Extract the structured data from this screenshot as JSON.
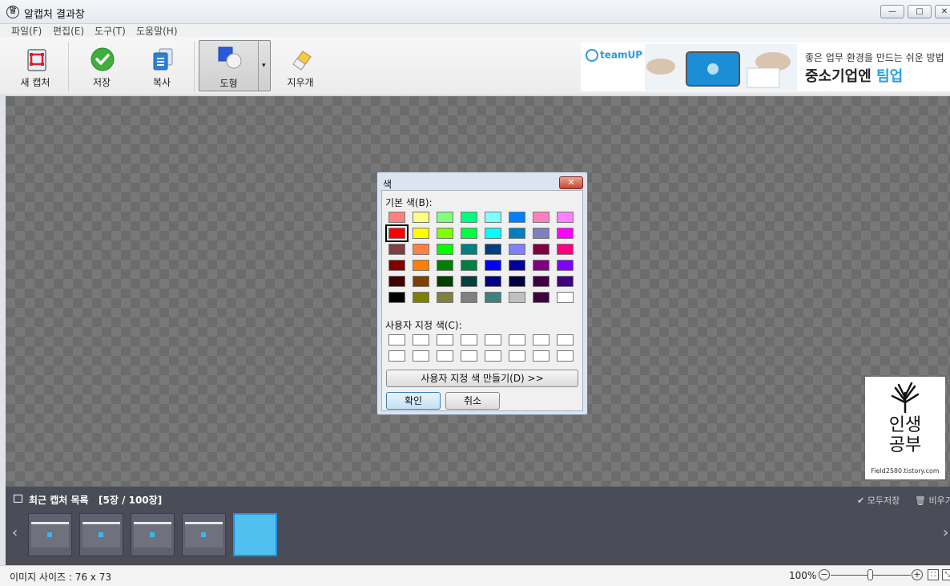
{
  "window": {
    "title": "알캡처 결과창",
    "minimize": "—",
    "maximize": "□",
    "close": "✕"
  },
  "menu": [
    "파일(F)",
    "편집(E)",
    "도구(T)",
    "도움말(H)"
  ],
  "toolbar": {
    "new_capture": "새 캡처",
    "save": "저장",
    "copy": "복사",
    "shape": "도형",
    "eraser": "지우개",
    "dropdown": "▾"
  },
  "banner": {
    "logo": "teamUP",
    "line1": "좋은 업무 환경을 만드는 쉬운 방법",
    "line2_main": "중소기업엔 ",
    "line2_accent": "팀업"
  },
  "watermark": {
    "line1": "인생",
    "line2": "공부",
    "url": "Field2580.tistory.com"
  },
  "color_dialog": {
    "title": "색",
    "close": "✕",
    "basic_label": "기본 색(B):",
    "custom_label": "사용자 지정 색(C):",
    "define_button": "사용자 지정 색 만들기(D) >>",
    "ok_button": "확인",
    "cancel_button": "취소",
    "selected_index": 8,
    "basic_colors": [
      "#ff8080",
      "#ffff80",
      "#80ff80",
      "#00ff80",
      "#80ffff",
      "#0080ff",
      "#ff80c0",
      "#ff80ff",
      "#ff0000",
      "#ffff00",
      "#80ff00",
      "#00ff40",
      "#00ffff",
      "#0080c0",
      "#8080c0",
      "#ff00ff",
      "#804040",
      "#ff8040",
      "#00ff00",
      "#008080",
      "#004080",
      "#8080ff",
      "#800040",
      "#ff0080",
      "#800000",
      "#ff8000",
      "#008000",
      "#008040",
      "#0000ff",
      "#0000a0",
      "#800080",
      "#8000ff",
      "#400000",
      "#804000",
      "#004000",
      "#004040",
      "#000080",
      "#000040",
      "#400040",
      "#400080",
      "#000000",
      "#808000",
      "#808040",
      "#808080",
      "#408080",
      "#c0c0c0",
      "#400040",
      "#ffffff"
    ],
    "custom_colors": [
      "#ffffff",
      "#ffffff",
      "#ffffff",
      "#ffffff",
      "#ffffff",
      "#ffffff",
      "#ffffff",
      "#ffffff",
      "#ffffff",
      "#ffffff",
      "#ffffff",
      "#ffffff",
      "#ffffff",
      "#ffffff",
      "#ffffff",
      "#ffffff"
    ]
  },
  "recent": {
    "title": "최근 캡처 목록",
    "count": "[5장 / 100장]",
    "save_all": "✔ 모두저장",
    "clear_all": "🗑 비우기",
    "prev": "‹",
    "next": "›",
    "thumbnail_count": 5,
    "active_thumbnail": 4
  },
  "status": {
    "image_size": "이미지 사이즈 : 76 x 73",
    "zoom": "100%",
    "zoom_level_fraction": 0.5,
    "zoom_minus": "−",
    "zoom_plus": "+"
  }
}
